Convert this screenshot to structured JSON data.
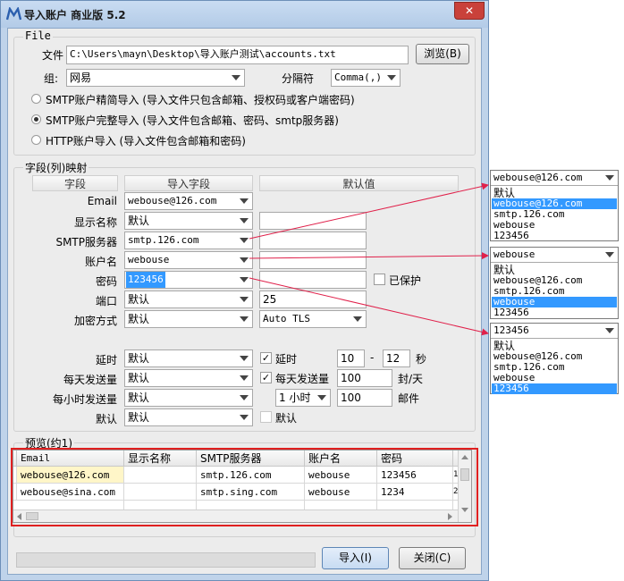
{
  "window": {
    "title": "导入账户 商业版 5.2",
    "close_glyph": "✕"
  },
  "file_group": {
    "title": "File",
    "file_label": "文件",
    "file_value": "C:\\Users\\mayn\\Desktop\\导入账户测试\\accounts.txt",
    "browse_label": "浏览(B)",
    "group_label": "组:",
    "group_value": "网易",
    "separator_label": "分隔符",
    "separator_value": "Comma(,)",
    "options": [
      {
        "label": "SMTP账户精简导入 (导入文件只包含邮箱、授权码或客户端密码)",
        "selected": false
      },
      {
        "label": "SMTP账户完整导入 (导入文件包含邮箱、密码、smtp服务器)",
        "selected": true
      },
      {
        "label": "HTTP账户导入 (导入文件包含邮箱和密码)",
        "selected": false
      }
    ]
  },
  "mapping_group": {
    "title": "字段(列)映射",
    "headers": {
      "field": "字段",
      "import_field": "导入字段",
      "default": "默认值"
    },
    "rows": [
      {
        "label": "Email",
        "combo": "webouse@126.com",
        "default": null
      },
      {
        "label": "显示名称",
        "combo": "默认",
        "default": ""
      },
      {
        "label": "SMTP服务器",
        "combo": "smtp.126.com",
        "default": ""
      },
      {
        "label": "账户名",
        "combo": "webouse",
        "default": ""
      },
      {
        "label": "密码",
        "combo": "123456",
        "default": "",
        "protect_label": "已保护",
        "protect_checked": false
      },
      {
        "label": "端口",
        "combo": "默认",
        "default": "25"
      },
      {
        "label": "加密方式",
        "combo": "默认",
        "default_combo": "Auto TLS"
      }
    ],
    "delay": {
      "label": "延时",
      "combo": "默认",
      "check_label": "延时",
      "checked": true,
      "from": "10",
      "dash": "-",
      "to": "12",
      "unit": "秒"
    },
    "daily": {
      "label": "每天发送量",
      "combo": "默认",
      "check_label": "每天发送量",
      "checked": true,
      "value": "100",
      "unit": "封/天"
    },
    "hourly": {
      "label": "每小时发送量",
      "combo": "默认",
      "period": "1 小时",
      "value": "100",
      "unit": "邮件"
    },
    "default_row": {
      "label": "默认",
      "combo": "默认",
      "check_label": "默认",
      "checked": false
    }
  },
  "preview_group": {
    "title": "预览(约1)",
    "columns": [
      "Email",
      "显示名称",
      "SMTP服务器",
      "账户名",
      "密码"
    ],
    "rows": [
      [
        "webouse@126.com",
        "",
        "smtp.126.com",
        "webouse",
        "123456"
      ],
      [
        "webouse@sina.com",
        "",
        "smtp.sing.com",
        "webouse",
        "1234"
      ]
    ],
    "row_numbers": [
      "1",
      "2"
    ],
    "highlight_color": "#e02020"
  },
  "footer": {
    "import_label": "导入(I)",
    "close_label": "关闭(C)"
  },
  "dropdowns": [
    {
      "value": "webouse@126.com",
      "items": [
        "默认",
        "webouse@126.com",
        "smtp.126.com",
        "webouse",
        "123456"
      ],
      "highlight": 1
    },
    {
      "value": "webouse",
      "items": [
        "默认",
        "webouse@126.com",
        "smtp.126.com",
        "webouse",
        "123456"
      ],
      "highlight": 3
    },
    {
      "value": "123456",
      "items": [
        "默认",
        "webouse@126.com",
        "smtp.126.com",
        "webouse",
        "123456"
      ],
      "highlight": 4
    }
  ],
  "colors": {
    "arrow": "#e0204a",
    "highlight": "#3399ff",
    "title_bar": "#bfd3ea",
    "close_button": "#c9413a"
  }
}
